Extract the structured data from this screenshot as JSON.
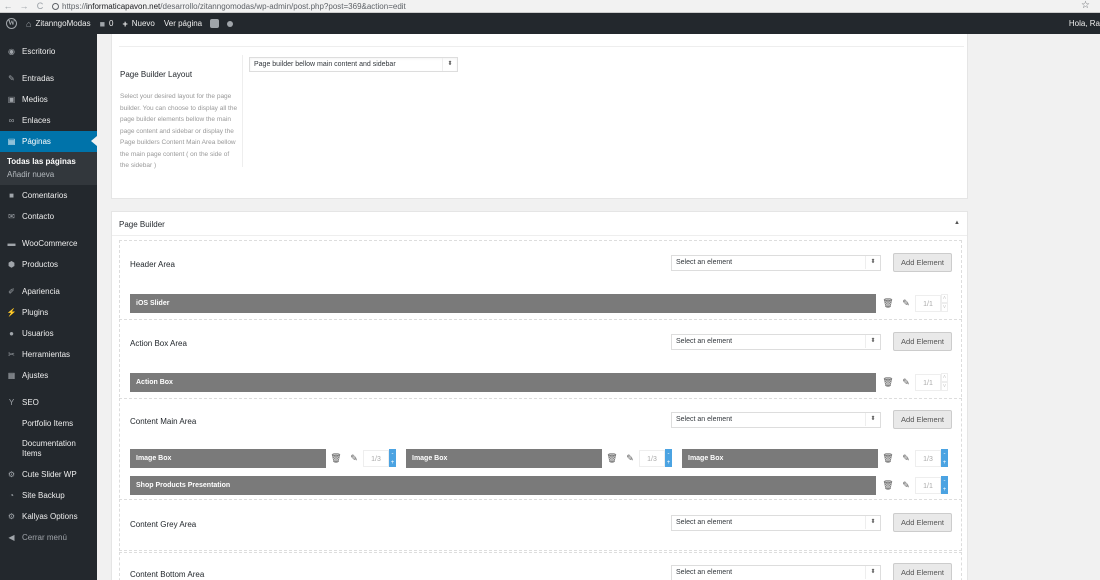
{
  "browser": {
    "url_prefix": "https://",
    "url_domain": "informaticapavon.net",
    "url_path": "/desarrollo/zitanngomodas/wp-admin/post.php?post=369&action=edit"
  },
  "adminbar": {
    "site_name": "ZitanngoModas",
    "comments_count": "0",
    "new_label": "Nuevo",
    "view_page_label": "Ver página",
    "greeting": "Hola, Ra"
  },
  "sidebar": {
    "items": [
      {
        "label": "Escritorio",
        "icon": "dashboard-icon"
      },
      {
        "label": "Entradas",
        "icon": "pin-icon"
      },
      {
        "label": "Medios",
        "icon": "media-icon"
      },
      {
        "label": "Enlaces",
        "icon": "link-icon"
      },
      {
        "label": "Páginas",
        "icon": "page-icon"
      },
      {
        "label": "Comentarios",
        "icon": "comment-icon"
      },
      {
        "label": "Contacto",
        "icon": "mail-icon"
      },
      {
        "label": "WooCommerce",
        "icon": "woo-icon"
      },
      {
        "label": "Productos",
        "icon": "product-icon"
      },
      {
        "label": "Apariencia",
        "icon": "brush-icon"
      },
      {
        "label": "Plugins",
        "icon": "plugin-icon"
      },
      {
        "label": "Usuarios",
        "icon": "user-icon"
      },
      {
        "label": "Herramientas",
        "icon": "wrench-icon"
      },
      {
        "label": "Ajustes",
        "icon": "settings-icon"
      },
      {
        "label": "SEO",
        "icon": "seo-icon"
      },
      {
        "label": "Portfolio Items",
        "icon": "portfolio-icon"
      },
      {
        "label": "Documentation Items",
        "icon": "doc-icon"
      },
      {
        "label": "Cute Slider WP",
        "icon": "slider-icon"
      },
      {
        "label": "Site Backup",
        "icon": "backup-icon"
      },
      {
        "label": "Kallyas Options",
        "icon": "options-icon"
      },
      {
        "label": "Cerrar menú",
        "icon": "collapse-icon"
      }
    ],
    "submenu": [
      "Todas las páginas",
      "Añadir nueva"
    ]
  },
  "layout_panel": {
    "label": "Page Builder Layout",
    "help": "Select your desired layout for the page builder. You can choose to display all the page builder elements bellow the main page content and sidebar or display the Page builders Content Main Area bellow the main page content ( on the side of the sidebar )",
    "select_value": "Page builder bellow main content and sidebar"
  },
  "page_builder": {
    "title": "Page Builder",
    "select_placeholder": "Select an element",
    "add_label": "Add Element",
    "areas": [
      {
        "name": "Header Area"
      },
      {
        "name": "Action Box Area"
      },
      {
        "name": "Content Main Area"
      },
      {
        "name": "Content Grey Area"
      },
      {
        "name": "Content Bottom Area"
      }
    ],
    "elements": [
      {
        "label": "iOS Slider",
        "size": "1/1"
      },
      {
        "label": "Action Box",
        "size": "1/1"
      },
      {
        "label": "Image Box",
        "size": "1/3"
      },
      {
        "label": "Image Box",
        "size": "1/3"
      },
      {
        "label": "Image Box",
        "size": "1/3"
      },
      {
        "label": "Shop Products Presentation",
        "size": "1/1"
      }
    ]
  },
  "colors": {
    "admin_dark": "#23282d",
    "accent_blue": "#0073aa",
    "element_bar": "#7a7a7a",
    "plus_blue": "#4ba3e2"
  }
}
